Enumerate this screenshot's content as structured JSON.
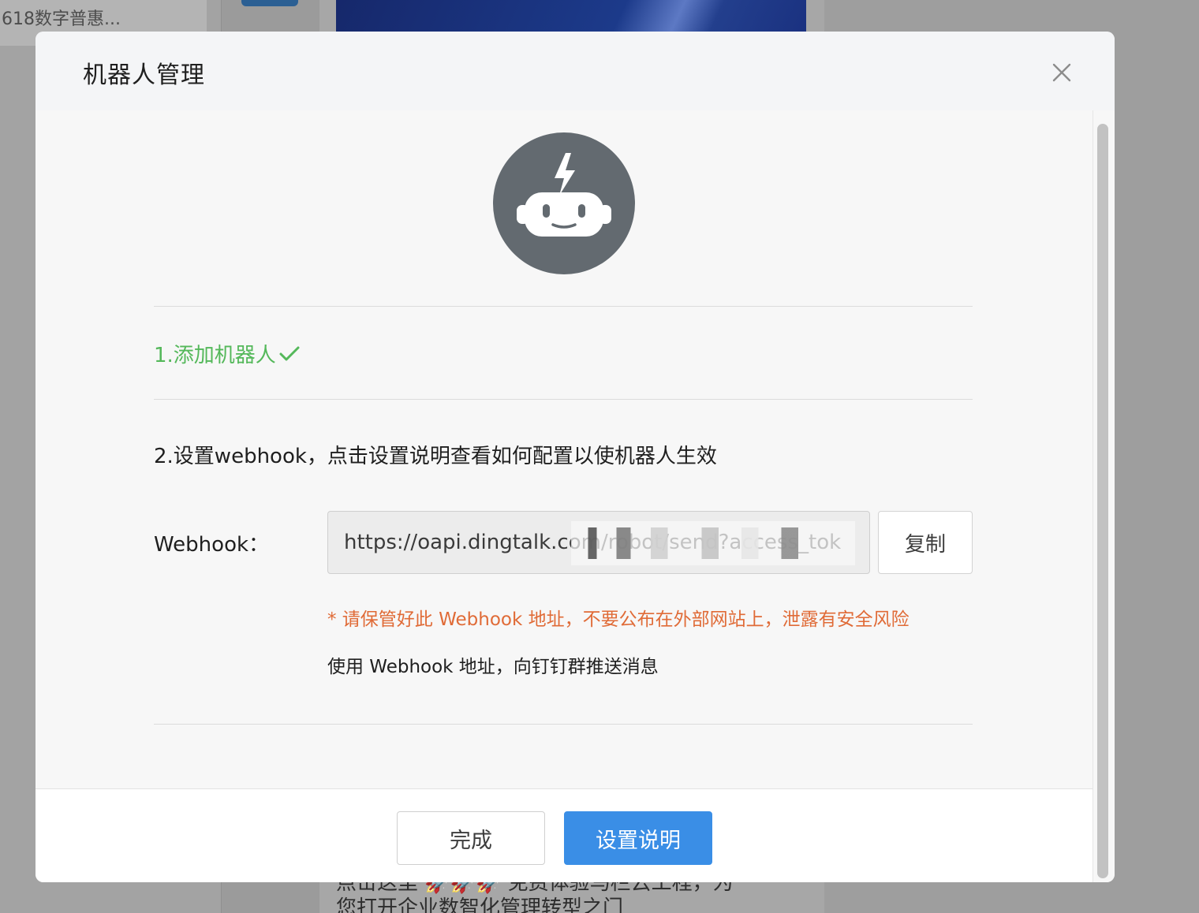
{
  "background": {
    "left_snippet": "618数字普惠...",
    "bottom_lines": [
      "点击这里 🚀🚀🚀 免费体验马栏云工程，为",
      "您打开企业数智化管理转型之门"
    ]
  },
  "modal": {
    "title": "机器人管理",
    "close_icon": "close-icon",
    "avatar_icon": "robot-icon",
    "step1": {
      "label": "1.添加机器人",
      "status_icon": "check-icon",
      "color": "#54b85a"
    },
    "step2": {
      "label": "2.设置webhook，点击设置说明查看如何配置以使机器人生效"
    },
    "webhook": {
      "label": "Webhook：",
      "value": "https://oapi.dingtalk.com/robot/send?access_tok",
      "copy_label": "复制"
    },
    "warning": "* 请保管好此 Webhook 地址，不要公布在外部网站上，泄露有安全风险",
    "usage": "使用 Webhook 地址，向钉钉群推送消息",
    "footer": {
      "done_label": "完成",
      "help_label": "设置说明"
    }
  },
  "colors": {
    "primary": "#3a8ee6",
    "success": "#54b85a",
    "warning": "#e06b37",
    "avatar_bg": "#636a70"
  }
}
